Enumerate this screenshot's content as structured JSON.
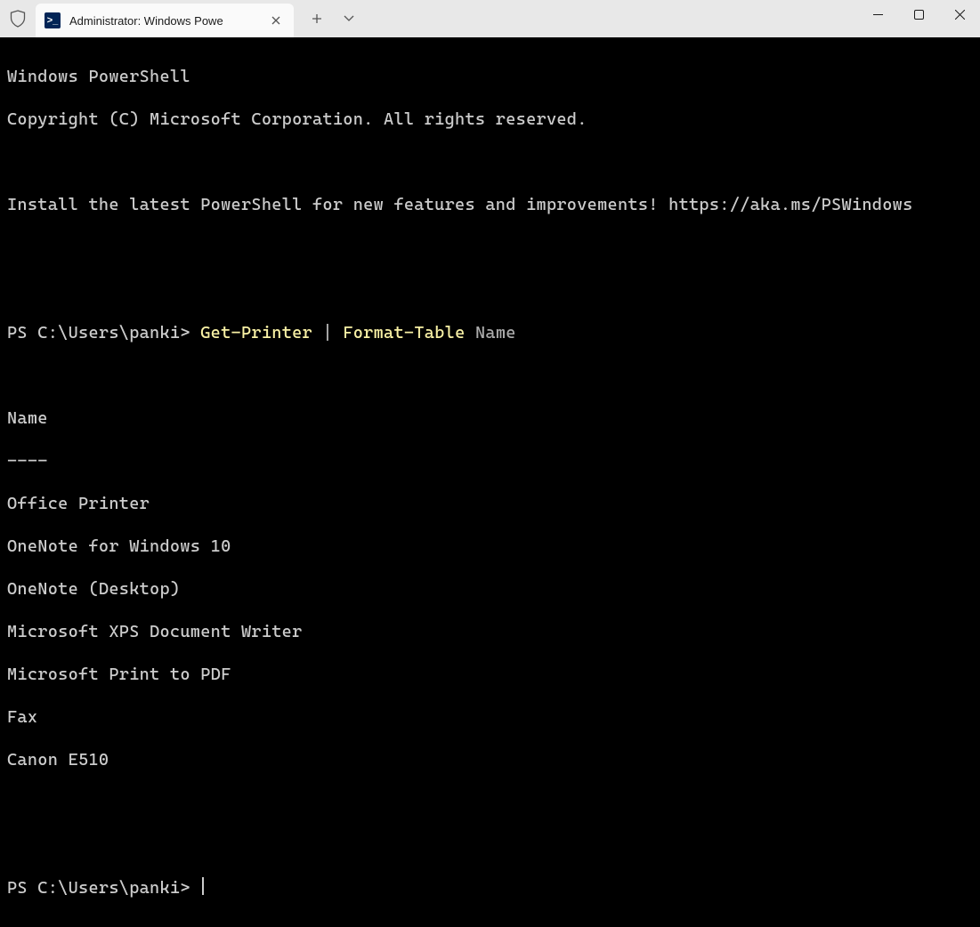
{
  "tab": {
    "title": "Administrator: Windows Powe"
  },
  "terminal": {
    "banner1": "Windows PowerShell",
    "banner2": "Copyright (C) Microsoft Corporation. All rights reserved.",
    "install_msg": "Install the latest PowerShell for new features and improvements! https://aka.ms/PSWindows",
    "prompt1": {
      "prefix": "PS C:\\Users\\panki> ",
      "cmd1": "Get-Printer",
      "pipe": " | ",
      "cmd2": "Format-Table",
      "arg": " Name"
    },
    "table": {
      "header": "Name",
      "divider": "----",
      "rows": [
        "Office Printer",
        "OneNote for Windows 10",
        "OneNote (Desktop)",
        "Microsoft XPS Document Writer",
        "Microsoft Print to PDF",
        "Fax",
        "Canon E510"
      ]
    },
    "prompt2": "PS C:\\Users\\panki> "
  }
}
